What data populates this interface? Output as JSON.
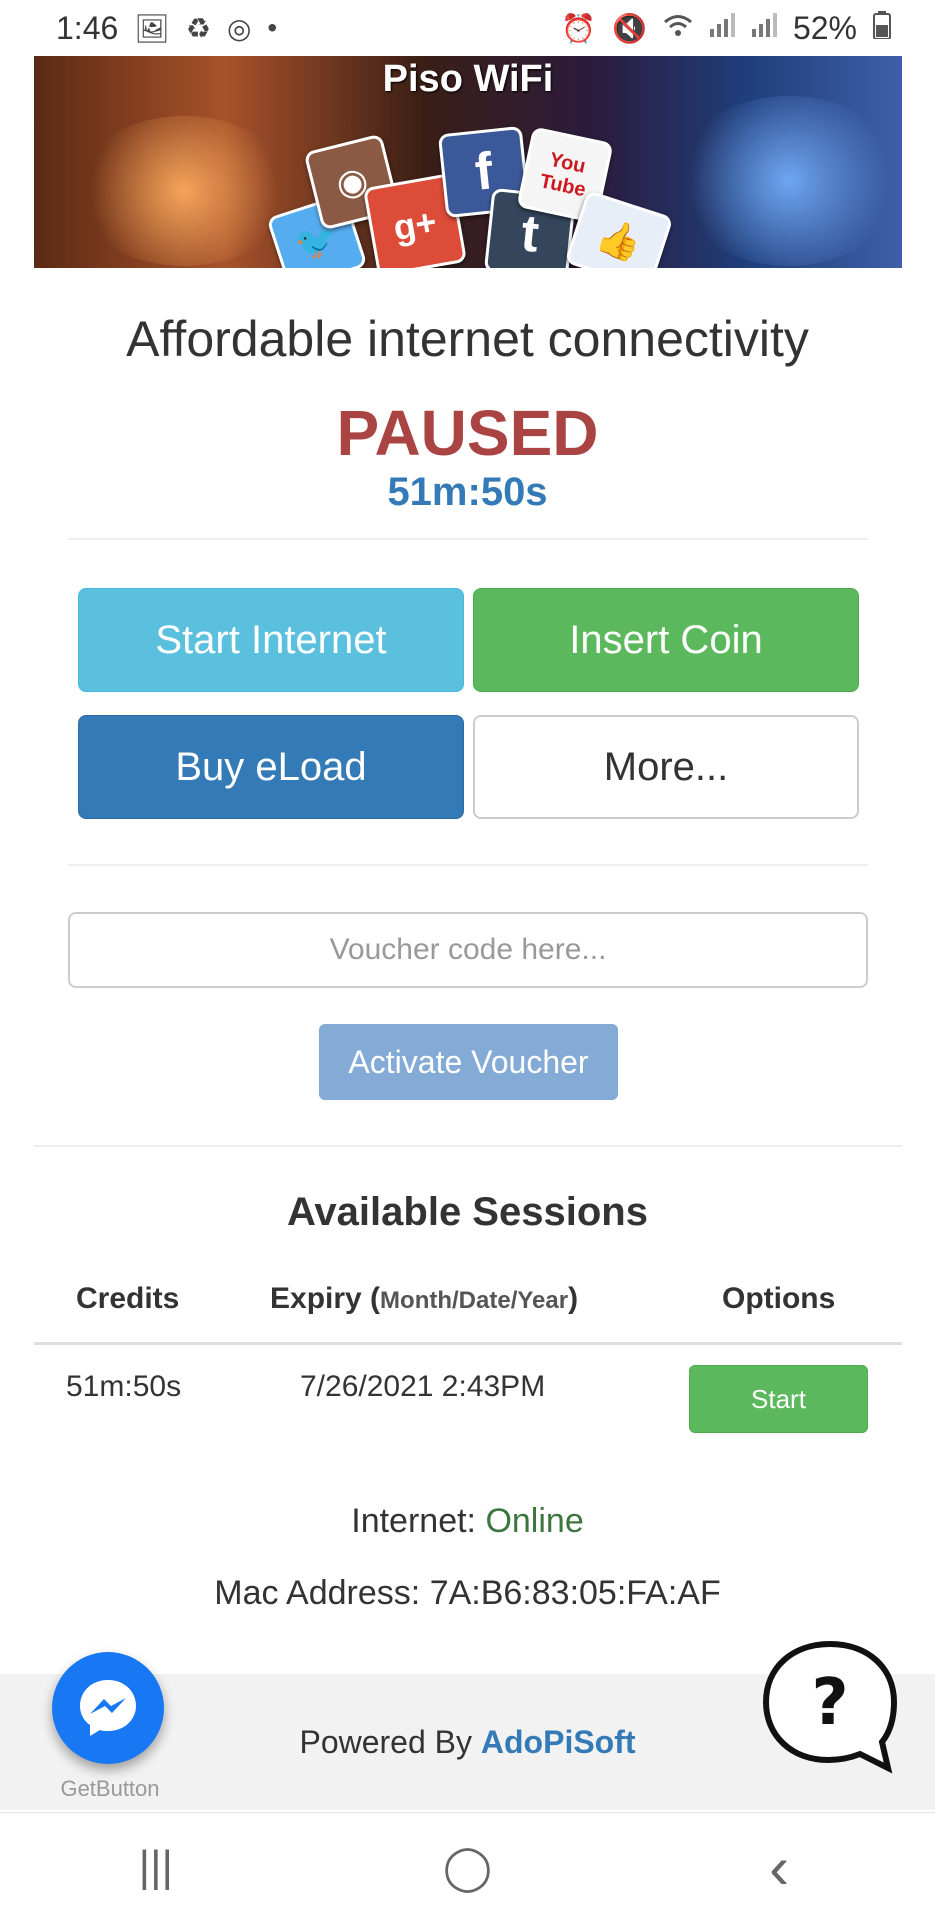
{
  "status_bar": {
    "time": "1:46",
    "battery": "52%",
    "left_icons": [
      "image-icon",
      "sync-icon",
      "chrome-icon",
      "dot-icon"
    ],
    "right_icons": [
      "alarm-icon",
      "mute-icon",
      "wifi-icon",
      "signal-icon",
      "signal-icon",
      "battery-icon"
    ]
  },
  "banner": {
    "title": "Piso WiFi",
    "social_icons": [
      "twitter-icon",
      "instagram-icon",
      "google-plus-icon",
      "facebook-icon",
      "tumblr-icon",
      "youtube-icon",
      "like-icon"
    ],
    "social_glyphs": {
      "twitter": "🐦",
      "instagram": "◉",
      "google_plus": "g+",
      "facebook": "f",
      "tumblr": "t",
      "youtube": "You Tube",
      "like": "👍"
    }
  },
  "hero": {
    "title": "Affordable internet connectivity",
    "status": "PAUSED",
    "timer": "51m:50s"
  },
  "actions": {
    "start_internet": "Start Internet",
    "insert_coin": "Insert Coin",
    "buy_eload": "Buy eLoad",
    "more": "More..."
  },
  "voucher": {
    "placeholder": "Voucher code here...",
    "activate_label": "Activate Voucher"
  },
  "sessions": {
    "title": "Available Sessions",
    "headers": {
      "credits": "Credits",
      "expiry": "Expiry",
      "expiry_note": "Month/Date/Year",
      "options": "Options"
    },
    "rows": [
      {
        "credits": "51m:50s",
        "expiry": "7/26/2021 2:43PM",
        "action": "Start"
      }
    ]
  },
  "info": {
    "internet_label": "Internet:",
    "internet_status": "Online",
    "mac_label": "Mac Address:",
    "mac_value": "7A:B6:83:05:FA:AF"
  },
  "footer": {
    "powered_label": "Powered By",
    "brand": "AdoPiSoft",
    "getbutton_label": "GetButton",
    "help_glyph": "?"
  },
  "nav": {
    "recents_glyph": "|||",
    "home_glyph": "◯",
    "back_glyph": "‹"
  },
  "colors": {
    "paused": "#a94442",
    "timer": "#337ab7",
    "info": "#5bc0de",
    "success": "#5cb85c",
    "primary": "#337ab7",
    "online": "#3c763d",
    "messenger": "#1877f2"
  }
}
